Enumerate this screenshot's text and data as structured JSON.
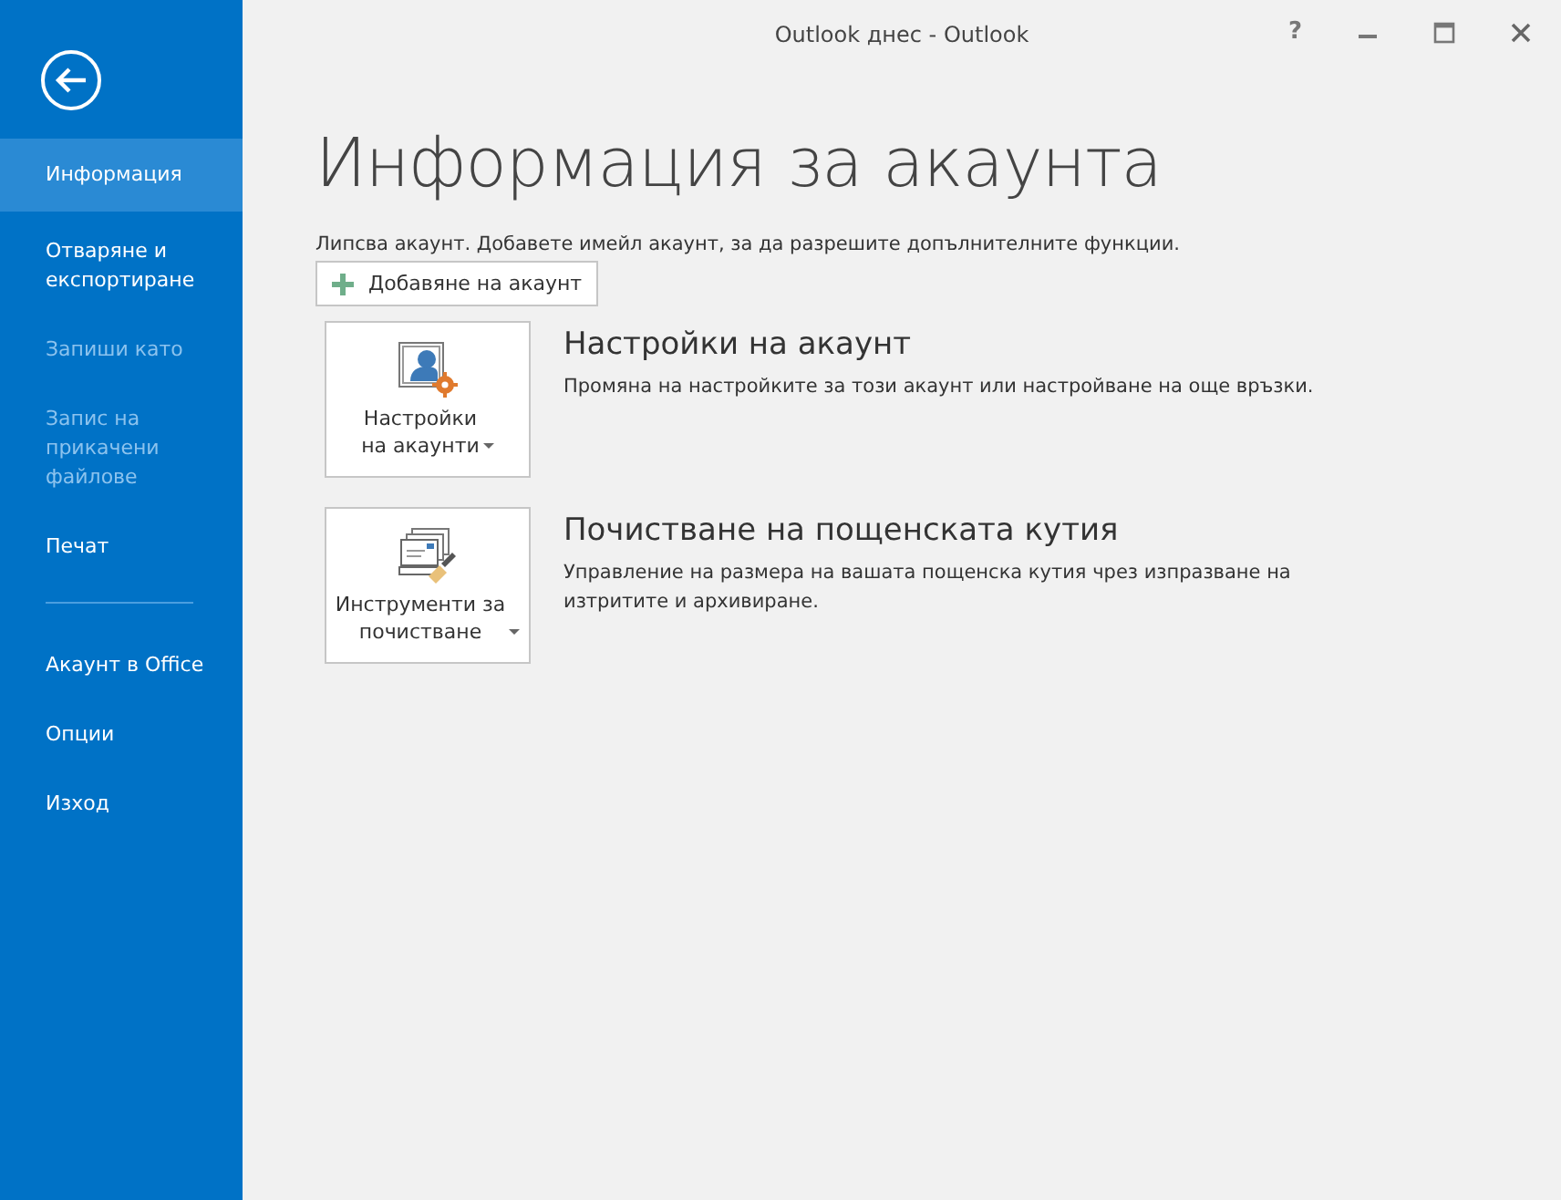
{
  "window": {
    "title": "Outlook днес - Outlook",
    "help": "?"
  },
  "sidebar": {
    "items": [
      {
        "kind": "item",
        "label": "Информация",
        "selected": true,
        "disabled": false
      },
      {
        "kind": "item",
        "label": "Отваряне и експортиране",
        "selected": false,
        "disabled": false
      },
      {
        "kind": "item",
        "label": "Запиши като",
        "selected": false,
        "disabled": true
      },
      {
        "kind": "item",
        "label": "Запис на прикачени файлове",
        "selected": false,
        "disabled": true
      },
      {
        "kind": "item",
        "label": "Печат",
        "selected": false,
        "disabled": false
      },
      {
        "kind": "separator"
      },
      {
        "kind": "item",
        "label": "Акаунт в Office",
        "selected": false,
        "disabled": false
      },
      {
        "kind": "item",
        "label": "Опции",
        "selected": false,
        "disabled": false
      },
      {
        "kind": "item",
        "label": "Изход",
        "selected": false,
        "disabled": false
      }
    ]
  },
  "page": {
    "title": "Информация за акаунта",
    "notice": "Липсва акаунт. Добавете имейл акаунт, за да разрешите допълнителните функции.",
    "add_button": "Добавяне на акаунт",
    "sections": [
      {
        "kind": "account-settings",
        "button_lines": [
          "Настройки",
          "на акаунти"
        ],
        "heading": "Настройки на акаунт",
        "description": "Промяна на настройките за този акаунт или настройване на още връзки."
      },
      {
        "kind": "cleanup",
        "button_lines": [
          "Инструменти за",
          "почистване"
        ],
        "heading": "Почистване на пощенската кутия",
        "description": "Управление на размера на вашата пощенска кутия чрез изпразване на изтритите и архивиране."
      }
    ]
  }
}
